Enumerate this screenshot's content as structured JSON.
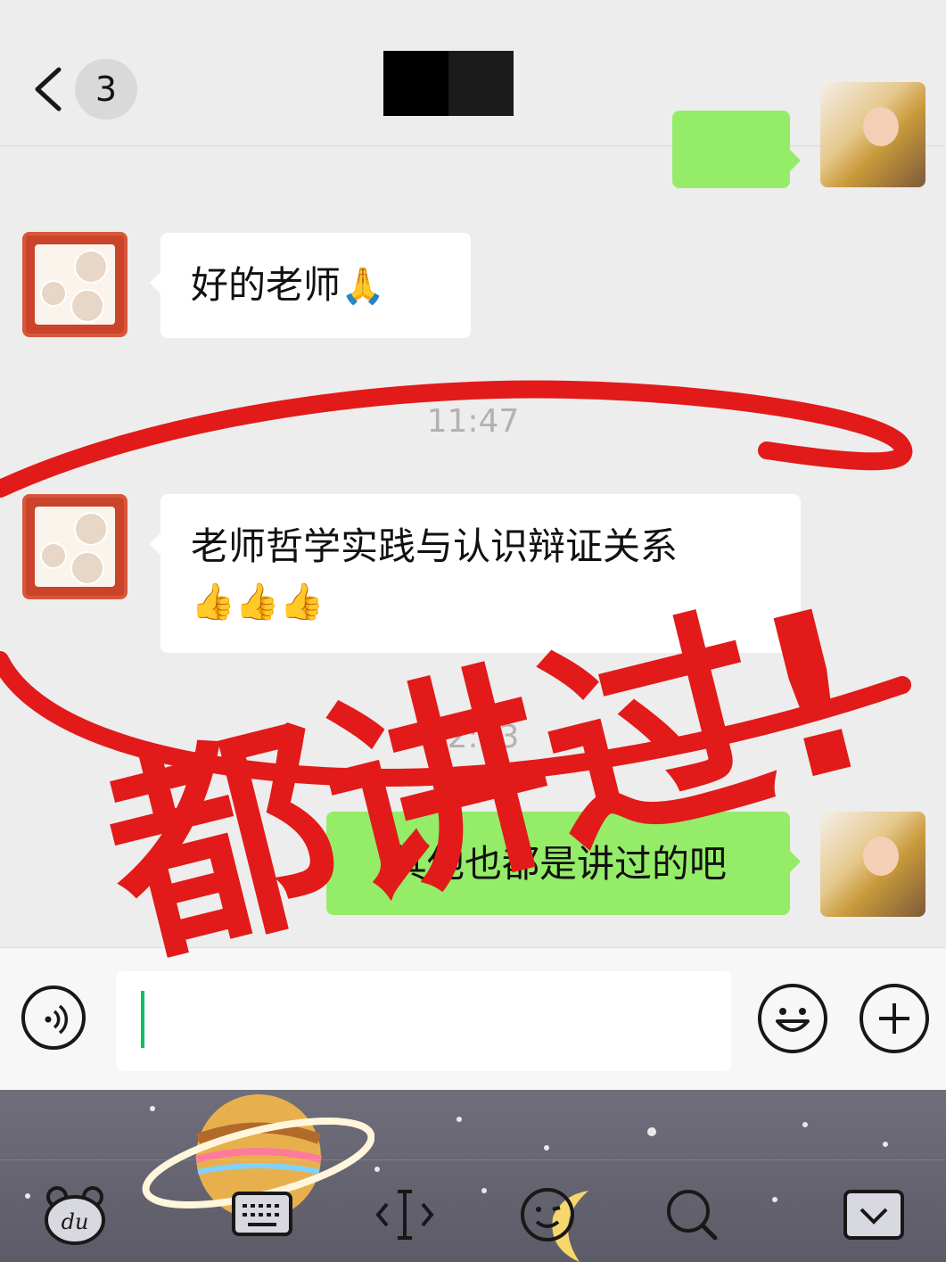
{
  "header": {
    "back_label": "<",
    "unread_count": "3"
  },
  "messages": [
    {
      "text": "好的老师",
      "emoji": "🙏"
    },
    {
      "timestamp": "11:47"
    },
    {
      "text": "老师哲学实践与认识辩证关系",
      "emoji": "👍👍👍"
    },
    {
      "timestamp": "12:03"
    },
    {
      "text": "其他也都是讲过的吧"
    }
  ],
  "annotation": {
    "stamp_text": "都讲过!",
    "stamp_color": "#e21a1a"
  },
  "colors": {
    "background": "#ededed",
    "incoming_bubble": "#ffffff",
    "outgoing_bubble": "#95ec69",
    "cursor": "#07c160"
  },
  "icons": {
    "voice": "voice-icon",
    "emoji": "emoji-icon",
    "plus": "plus-icon",
    "keyboard_toolbar": [
      "du-bear-icon",
      "keyboard-icon",
      "cursor-move-icon",
      "sticker-icon",
      "search-icon",
      "collapse-keyboard-icon"
    ]
  }
}
